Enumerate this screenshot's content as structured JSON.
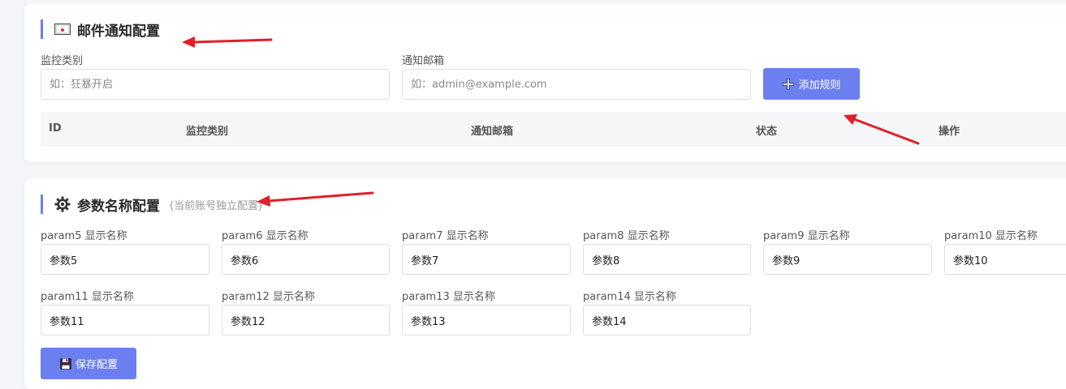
{
  "mail_section": {
    "title": "邮件通知配置",
    "category_label": "监控类别",
    "category_placeholder": "如：狂暴开启",
    "email_label": "通知邮箱",
    "email_placeholder": "如：admin@example.com",
    "add_button_label": "添加规则",
    "table_headers": [
      "ID",
      "监控类别",
      "通知邮箱",
      "状态",
      "操作"
    ]
  },
  "param_section": {
    "title": "参数名称配置",
    "subtitle": "(当前账号独立配置)",
    "params": [
      {
        "label": "param5 显示名称",
        "value": "参数5"
      },
      {
        "label": "param6 显示名称",
        "value": "参数6"
      },
      {
        "label": "param7 显示名称",
        "value": "参数7"
      },
      {
        "label": "param8 显示名称",
        "value": "参数8"
      },
      {
        "label": "param9 显示名称",
        "value": "参数9"
      },
      {
        "label": "param10 显示名称",
        "value": "参数10"
      },
      {
        "label": "param11 显示名称",
        "value": "参数11"
      },
      {
        "label": "param12 显示名称",
        "value": "参数12"
      },
      {
        "label": "param13 显示名称",
        "value": "参数13"
      },
      {
        "label": "param14 显示名称",
        "value": "参数14"
      }
    ],
    "save_button_label": "保存配置"
  },
  "colors": {
    "accent": "#6b7ff0",
    "annotation_arrow": "#e0202a"
  },
  "icons": {
    "mail_title": "envelope-icon",
    "param_title": "gear-icon",
    "add_button": "plus-icon",
    "save_button": "floppy-disk-icon"
  }
}
